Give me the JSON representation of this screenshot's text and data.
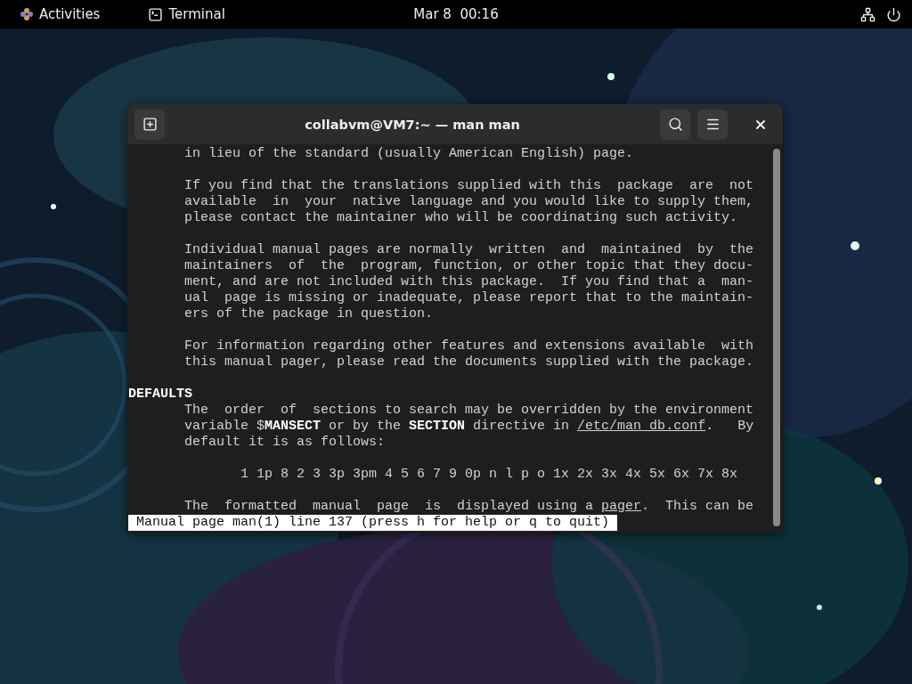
{
  "top_bar": {
    "activities": "Activities",
    "app_name": "Terminal",
    "clock": "Mar 8  00:16"
  },
  "window": {
    "title": "collabvm@VM7:~ — man man",
    "blocks": [
      {
        "kind": "paragraph",
        "lines": [
          "in lieu of the standard (usually American English) page."
        ]
      },
      {
        "kind": "paragraph",
        "lines": [
          "If you find that the translations supplied with this  package  are  not",
          "available  in  your  native language and you would like to supply them,",
          "please contact the maintainer who will be coordinating such activity."
        ]
      },
      {
        "kind": "paragraph",
        "lines": [
          "Individual manual pages are normally  written  and  maintained  by  the",
          "maintainers  of  the  program, function, or other topic that they docu-",
          "ment, and are not included with this package.  If you find that a  man-",
          "ual  page is missing or inadequate, please report that to the maintain-",
          "ers of the package in question."
        ]
      },
      {
        "kind": "paragraph",
        "lines": [
          "For information regarding other features and extensions available  with",
          "this manual pager, please read the documents supplied with the package."
        ]
      },
      {
        "kind": "heading",
        "lines": [
          "DEFAULTS"
        ]
      },
      {
        "kind": "paragraph",
        "lines": [
          "The  order  of  sections to search may be overridden by the environment",
          {
            "parts": [
              {
                "text": "variable $",
                "kind": "plain"
              },
              {
                "text": "MANSECT",
                "kind": "bold"
              },
              {
                "text": " or by the ",
                "kind": "plain"
              },
              {
                "text": "SECTION",
                "kind": "bold"
              },
              {
                "text": " directive in ",
                "kind": "plain"
              },
              {
                "text": "/etc/man_db.conf",
                "kind": "underline"
              },
              {
                "text": ".   By",
                "kind": "plain"
              }
            ]
          },
          "default it is as follows:"
        ]
      },
      {
        "kind": "list",
        "lines": [
          "1 1p 8 2 3 3p 3pm 4 5 6 7 9 0p n l p o 1x 2x 3x 4x 5x 6x 7x 8x"
        ]
      },
      {
        "kind": "paragraph",
        "lines": [
          {
            "parts": [
              {
                "text": "The  formatted  manual  page  is  displayed using a ",
                "kind": "plain"
              },
              {
                "text": "pager",
                "kind": "underline"
              },
              {
                "text": ".  This can be",
                "kind": "plain"
              }
            ]
          }
        ]
      }
    ],
    "status_line": "Manual page man(1) line 137 (press h for help or q to quit)"
  }
}
